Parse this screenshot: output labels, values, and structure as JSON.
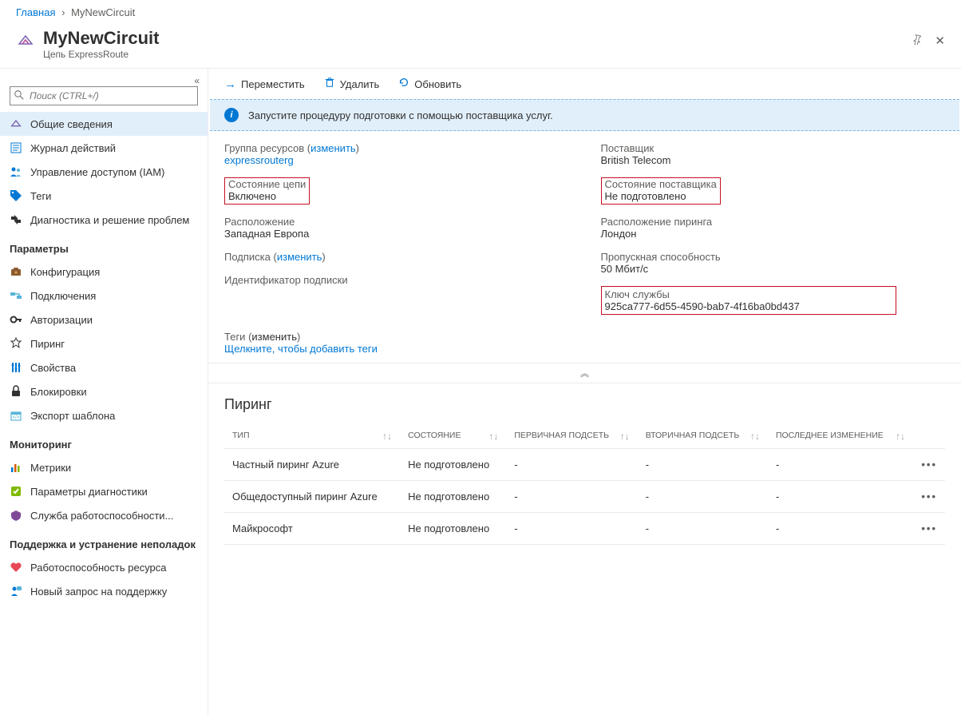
{
  "breadcrumb": {
    "home": "Главная",
    "current": "MyNewCircuit"
  },
  "header": {
    "title": "MyNewCircuit",
    "subtitle": "Цепь ExpressRoute"
  },
  "search": {
    "placeholder": "Поиск (CTRL+/)"
  },
  "nav": {
    "items": [
      {
        "label": "Общие сведения",
        "icon": "overview"
      },
      {
        "label": "Журнал действий",
        "icon": "activity"
      },
      {
        "label": "Управление доступом (IAM)",
        "icon": "iam"
      },
      {
        "label": "Теги",
        "icon": "tags"
      },
      {
        "label": "Диагностика и решение проблем",
        "icon": "diagnose"
      }
    ],
    "sections": {
      "settings": "Параметры",
      "settings_items": [
        {
          "label": "Конфигурация",
          "icon": "config"
        },
        {
          "label": "Подключения",
          "icon": "connections"
        },
        {
          "label": "Авторизации",
          "icon": "auth"
        },
        {
          "label": "Пиринг",
          "icon": "peering"
        },
        {
          "label": "Свойства",
          "icon": "properties"
        },
        {
          "label": "Блокировки",
          "icon": "locks"
        },
        {
          "label": "Экспорт шаблона",
          "icon": "export"
        }
      ],
      "monitoring": "Мониторинг",
      "monitoring_items": [
        {
          "label": "Метрики",
          "icon": "metrics"
        },
        {
          "label": "Параметры диагностики",
          "icon": "diag-settings"
        },
        {
          "label": "Служба работоспособности...",
          "icon": "health"
        }
      ],
      "support": "Поддержка и устранение неполадок",
      "support_items": [
        {
          "label": "Работоспособность ресурса",
          "icon": "res-health"
        },
        {
          "label": "Новый запрос на поддержку",
          "icon": "support-req"
        }
      ]
    }
  },
  "toolbar": {
    "move": "Переместить",
    "delete": "Удалить",
    "refresh": "Обновить"
  },
  "banner": "Запустите процедуру подготовки с помощью поставщика услуг.",
  "properties": {
    "rg_label": "Группа ресурсов",
    "rg_change": "изменить",
    "rg_value": "expressrouterg",
    "circuit_status_label": "Состояние цепи",
    "circuit_status_value": "Включено",
    "location_label": "Расположение",
    "location_value": "Западная Европа",
    "subscription_label": "Подписка",
    "subscription_change": "изменить",
    "subid_label": "Идентификатор подписки",
    "provider_label": "Поставщик",
    "provider_value": "British Telecom",
    "provider_status_label": "Состояние поставщика",
    "provider_status_value": "Не подготовлено",
    "peering_loc_label": "Расположение пиринга",
    "peering_loc_value": "Лондон",
    "bandwidth_label": "Пропускная способность",
    "bandwidth_value": "50 Мбит/с",
    "servicekey_label": "Ключ службы",
    "servicekey_value": "925ca777-6d55-4590-bab7-4f16ba0bd437",
    "tags_label": "Теги",
    "tags_change": "изменить",
    "tags_add": "Щелкните, чтобы добавить теги"
  },
  "peering": {
    "title": "Пиринг",
    "columns": {
      "type": "ТИП",
      "status": "СОСТОЯНИЕ",
      "primary": "ПЕРВИЧНАЯ ПОДСЕТЬ",
      "secondary": "ВТОРИЧНАЯ ПОДСЕТЬ",
      "modified": "ПОСЛЕДНЕЕ ИЗМЕНЕНИЕ"
    },
    "rows": [
      {
        "type": "Частный пиринг Azure",
        "status": "Не подготовлено",
        "primary": "-",
        "secondary": "-",
        "modified": "-"
      },
      {
        "type": "Общедоступный пиринг Azure",
        "status": "Не подготовлено",
        "primary": "-",
        "secondary": "-",
        "modified": "-"
      },
      {
        "type": "Майкрософт",
        "status": "Не подготовлено",
        "primary": "-",
        "secondary": "-",
        "modified": "-"
      }
    ]
  }
}
